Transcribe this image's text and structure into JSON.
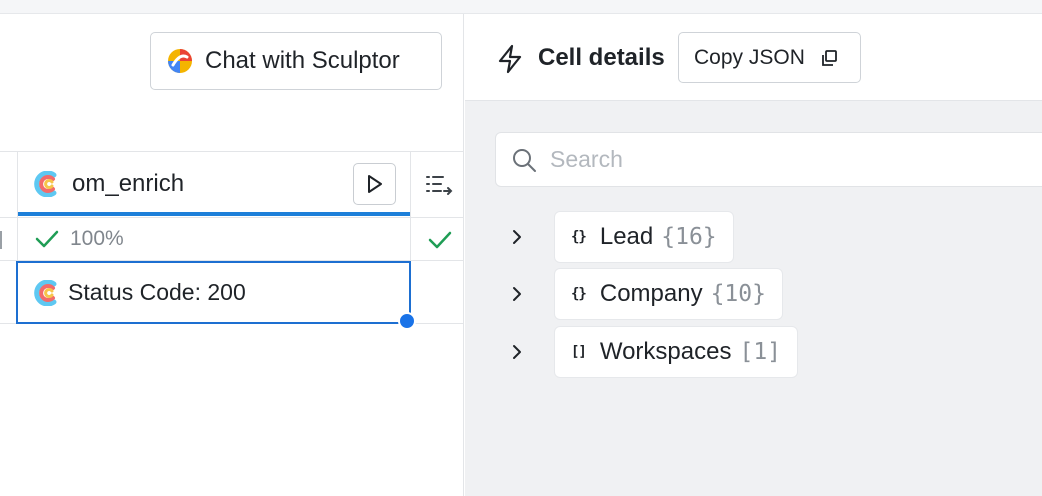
{
  "left": {
    "chat_button": {
      "label": "Chat with Sculptor",
      "icon": "sculptor-logo-icon"
    },
    "column": {
      "name": "om_enrich",
      "progress": "100%",
      "selected_cell_value": "Status Code: 200"
    }
  },
  "details": {
    "title": "Cell details",
    "copy_button": "Copy JSON",
    "search": {
      "placeholder": "Search",
      "value": ""
    },
    "tree": [
      {
        "type_symbol": "{}",
        "key": "Lead",
        "count": "{16}"
      },
      {
        "type_symbol": "{}",
        "key": "Company",
        "count": "{10}"
      },
      {
        "type_symbol": "[]",
        "key": "Workspaces",
        "count": "[1]"
      }
    ]
  },
  "colors": {
    "accent_blue": "#1d7fd9",
    "success_green": "#1f9d55",
    "panel_gray": "#f0f1f3"
  }
}
